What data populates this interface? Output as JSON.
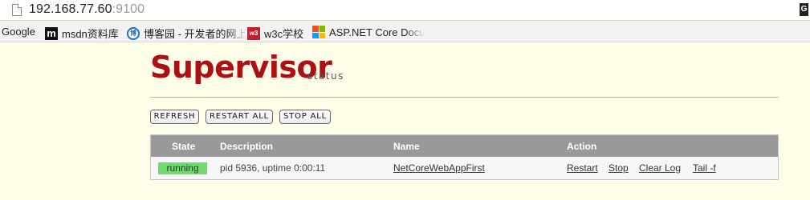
{
  "browser": {
    "url_host": "192.168.77.60",
    "url_port": ":9100",
    "bookmarks": [
      {
        "label": "Google"
      },
      {
        "label": "msdn资料库",
        "icon_text": "m"
      },
      {
        "label": "博客园 - 开发者的网上",
        "icon_text": "博"
      },
      {
        "label": "w3c学校",
        "icon_text": "w3"
      },
      {
        "label": "ASP.NET Core Docu"
      }
    ]
  },
  "page": {
    "logo": "Supervisor",
    "logo_sub": "status",
    "buttons": {
      "refresh": "REFRESH",
      "restart_all": "RESTART ALL",
      "stop_all": "STOP ALL"
    },
    "table": {
      "headers": {
        "state": "State",
        "description": "Description",
        "name": "Name",
        "action": "Action"
      },
      "rows": [
        {
          "state": "running",
          "description": "pid 5936, uptime 0:00:11",
          "name": "NetCoreWebAppFirst",
          "actions": {
            "restart": "Restart",
            "stop": "Stop",
            "clear_log": "Clear Log",
            "tail": "Tail -f"
          }
        }
      ]
    }
  },
  "colors": {
    "brand": "#aa1014",
    "running": "#6cdc6c",
    "header_bg": "#999999",
    "page_bg": "#fefee8"
  }
}
